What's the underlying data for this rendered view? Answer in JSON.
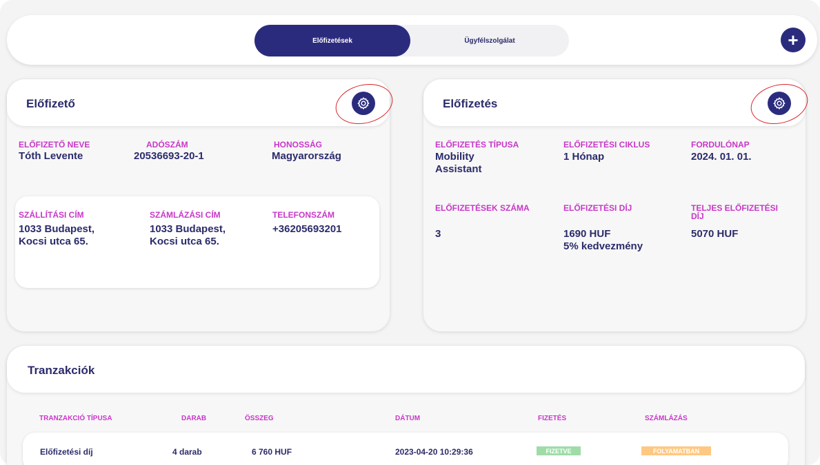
{
  "tabs": [
    {
      "label": "Előfizetések",
      "active": true
    },
    {
      "label": "Ügyfélszolgálat",
      "active": false
    }
  ],
  "add_button": {
    "icon": "plus-icon",
    "symbol": "+"
  },
  "subscriber": {
    "title": "Előfizető",
    "fields": [
      {
        "label": "ELŐFIZETŐ NEVE",
        "value": "Tóth Levente"
      },
      {
        "label": "ADÓSZÁM",
        "value": "20536693-20-1"
      },
      {
        "label": "HONOSSÁG",
        "value": "Magyarország"
      }
    ],
    "address_box": [
      {
        "label": "SZÁLLÍTÁSI CÍM",
        "value": "1033 Budapest,\nKocsi utca 65."
      },
      {
        "label": "SZÁMLÁZÁSI CÍM",
        "value": "1033 Budapest,\nKocsi utca 65."
      },
      {
        "label": "TELEFONSZÁM",
        "value": "+36205693201"
      }
    ]
  },
  "subscription": {
    "title": "Előfizetés",
    "fields": [
      {
        "label": "ELŐFIZETÉS TÍPUSA",
        "value": "Mobility\nAssistant"
      },
      {
        "label": "ELŐFIZETÉSI CIKLUS",
        "value": "1 Hónap"
      },
      {
        "label": "FORDULÓNAP",
        "value": "2024. 01. 01."
      },
      {
        "label": "ELŐFIZETÉSEK SZÁMA",
        "value": "3"
      },
      {
        "label": "ELŐFIZETÉSI DÍJ",
        "value": "1690 HUF\n5% kedvezmény"
      },
      {
        "label": "TELJES ELŐFIZETÉSI\nDÍJ",
        "value": "5070 HUF"
      }
    ]
  },
  "transactions": {
    "title": "Tranzakciók",
    "columns": [
      "TRANZAKCIÓ TÍPUSA",
      "DARAB",
      "ÖSSZEG",
      "DÁTUM",
      "FIZETÉS",
      "SZÁMLÁZÁS"
    ],
    "rows": [
      {
        "type": "Előfizetési díj",
        "count": "4 darab",
        "amount": "6 760 HUF",
        "date": "2023-04-20 10:29:36",
        "payment": "FIZETVE",
        "billing": "FOLYAMATBAN"
      }
    ]
  },
  "colors": {
    "primary": "#2b2b7e",
    "label": "#c837c8",
    "paid": "#9fdca8",
    "in_progress": "#ffc882",
    "annotation": "#d8252c"
  }
}
